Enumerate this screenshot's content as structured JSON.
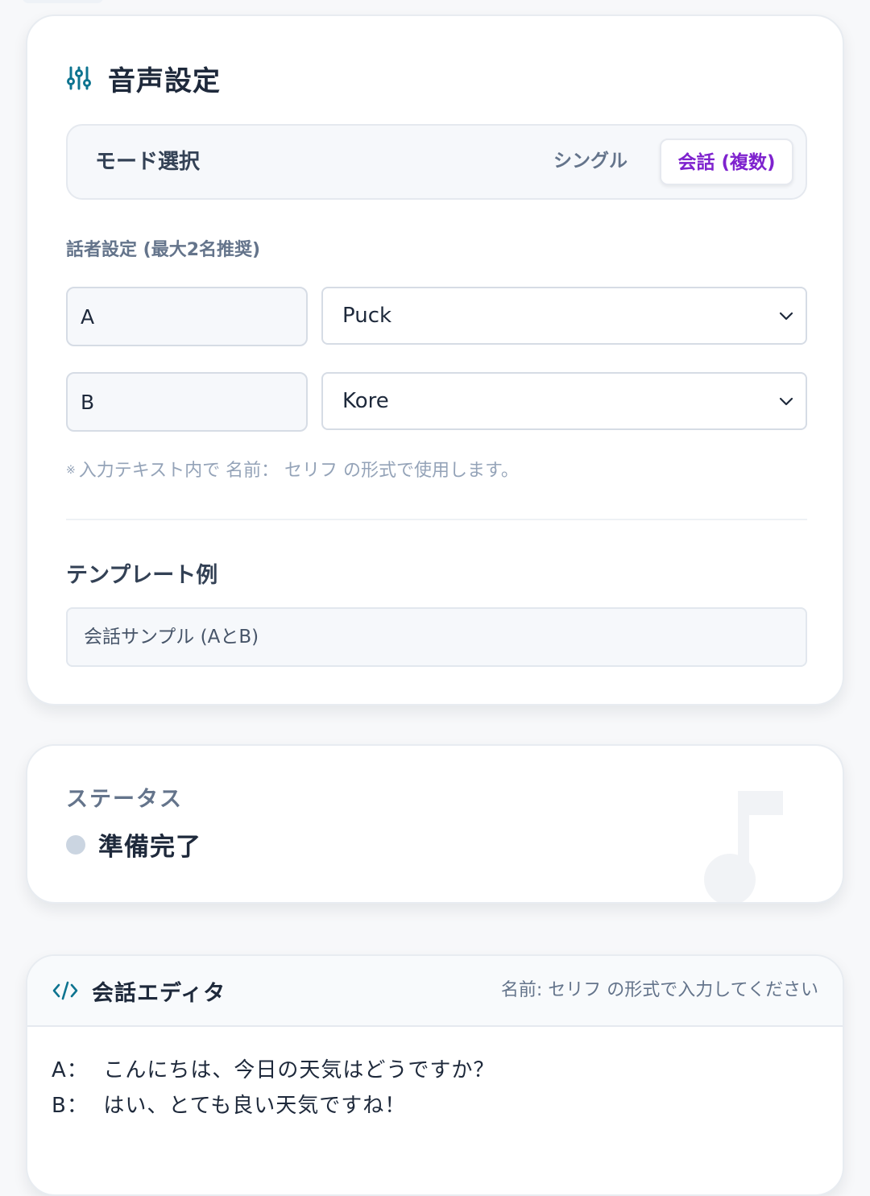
{
  "voice_settings": {
    "title": "音声設定",
    "icon": "sliders-icon",
    "mode": {
      "label": "モード選択",
      "options": [
        "シングル",
        "会話 (複数)"
      ],
      "selected": "会話 (複数)"
    },
    "speaker_heading": "話者設定 (最大2名推奨)",
    "speakers": [
      {
        "name": "A",
        "voice": "Puck"
      },
      {
        "name": "B",
        "voice": "Kore"
      }
    ],
    "hint_mark": "※",
    "hint": "入力テキスト内で 名前： セリフ の形式で使用します。",
    "template_heading": "テンプレート例",
    "template_selected": "会話サンプル (AとB)"
  },
  "status": {
    "heading": "ステータス",
    "text": "準備完了",
    "dot_color": "#cbd5e1"
  },
  "editor": {
    "title": "会話エディタ",
    "icon": "code-icon",
    "hint": "名前: セリフ の形式で入力してください",
    "lines": [
      "A：  こんにちは、今日の天気はどうですか？",
      "B：  はい、とても良い天気ですね！"
    ]
  },
  "colors": {
    "accent_purple": "#7e22ce",
    "accent_teal": "#0e7490"
  }
}
